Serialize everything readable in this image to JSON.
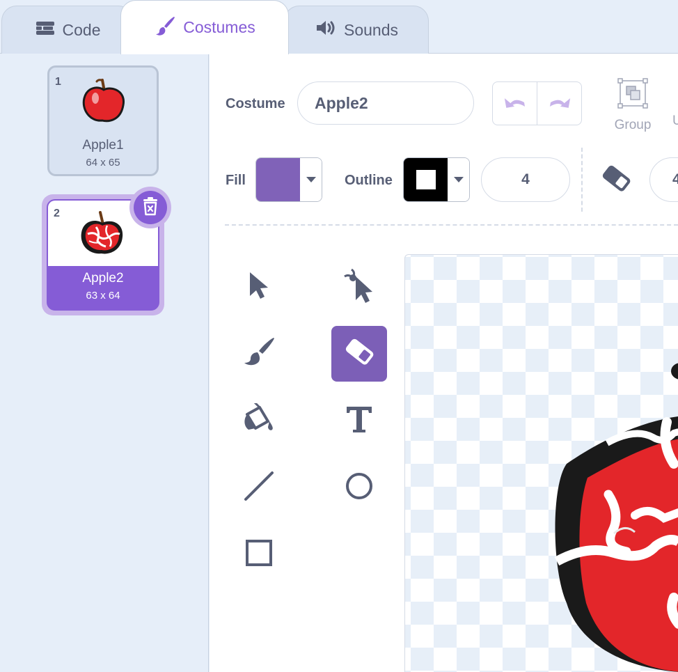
{
  "tabs": [
    {
      "label": "Code",
      "icon": "code-blocks-icon"
    },
    {
      "label": "Costumes",
      "icon": "paintbrush-icon",
      "active": true
    },
    {
      "label": "Sounds",
      "icon": "speaker-icon"
    }
  ],
  "costumes": [
    {
      "number": "1",
      "name": "Apple1",
      "size": "64 x 65"
    },
    {
      "number": "2",
      "name": "Apple2",
      "size": "63 x 64",
      "selected": true
    }
  ],
  "editor": {
    "costume_label": "Costume",
    "costume_name": "Apple2",
    "group_label": "Group",
    "ungroup_label_peek": "U",
    "fill_label": "Fill",
    "outline_label": "Outline",
    "outline_width": "4",
    "eraser_size_peek": "4",
    "active_tool": "eraser"
  },
  "colors": {
    "accent": "#855cd6",
    "fill": "#8062b8",
    "outline": "#000000",
    "apple_red": "#e3262a"
  },
  "tools": [
    {
      "name": "select",
      "icon": "arrow-cursor-icon"
    },
    {
      "name": "reshape",
      "icon": "reshape-cursor-icon"
    },
    {
      "name": "brush",
      "icon": "brush-icon"
    },
    {
      "name": "eraser",
      "icon": "eraser-icon"
    },
    {
      "name": "fill",
      "icon": "paint-bucket-icon"
    },
    {
      "name": "text",
      "icon": "text-icon"
    },
    {
      "name": "line",
      "icon": "line-icon"
    },
    {
      "name": "circle",
      "icon": "circle-icon"
    },
    {
      "name": "rectangle",
      "icon": "rectangle-icon"
    }
  ]
}
